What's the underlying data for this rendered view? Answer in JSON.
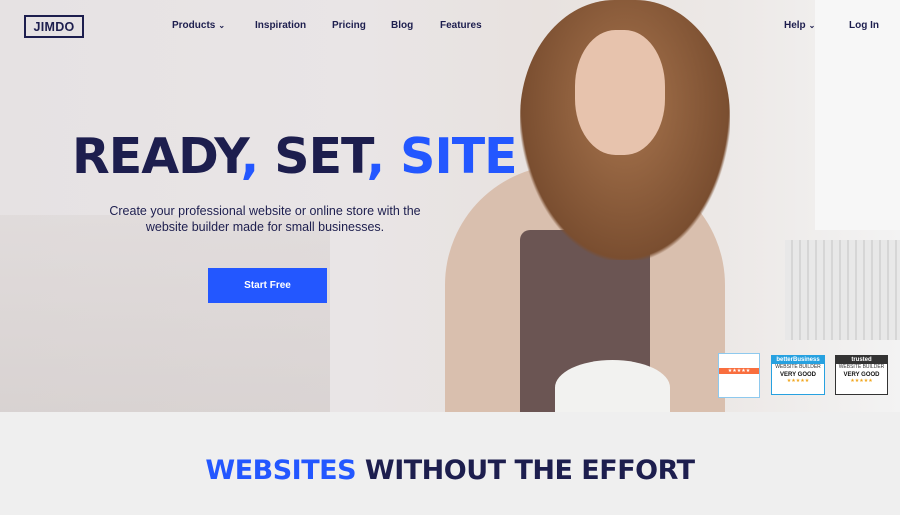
{
  "nav": {
    "logo": "JIMDO",
    "items": [
      {
        "label": "Products",
        "has_dropdown": true
      },
      {
        "label": "Inspiration"
      },
      {
        "label": "Pricing"
      },
      {
        "label": "Blog"
      },
      {
        "label": "Features"
      }
    ],
    "help": "Help",
    "login": "Log In"
  },
  "hero": {
    "title_part1": "READY",
    "sep1": ",",
    "title_part2": " SET",
    "sep2": ",",
    "title_highlight": " SITE",
    "subtitle": "Create your professional website or online store with the website builder made for small businesses.",
    "cta": "Start Free"
  },
  "badges": [
    {
      "stars": "★★★★★"
    },
    {
      "header": "betterBusiness",
      "category": "WEBSITE BUILDER",
      "rating": "VERY GOOD",
      "stars": "★★★★★"
    },
    {
      "header": "trusted",
      "category": "WEBSITE BUILDER",
      "rating": "VERY GOOD",
      "stars": "★★★★★"
    }
  ],
  "section": {
    "title_highlight": "WEBSITES",
    "title_rest": " WITHOUT THE EFFORT"
  },
  "colors": {
    "brand_blue": "#2357ff",
    "navy": "#1d1e4e"
  }
}
